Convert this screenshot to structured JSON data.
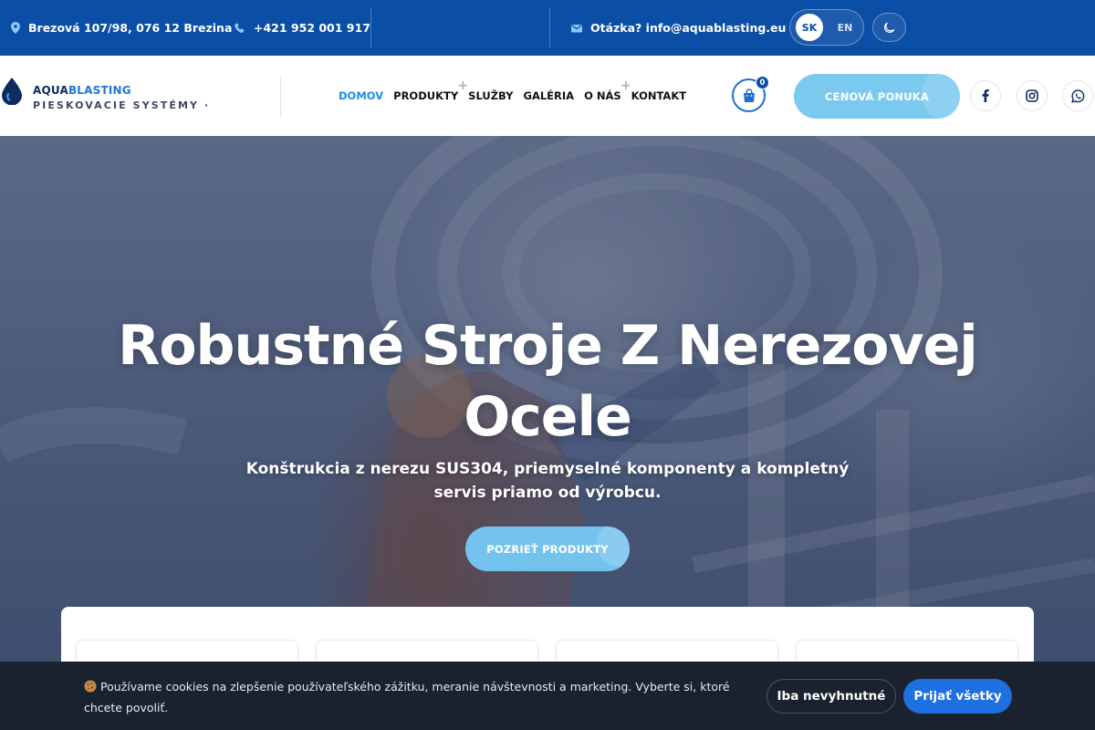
{
  "topbar": {
    "address": "Brezová 107/98, 076 12 Brezina",
    "phone": "+421 952 001 917",
    "email_label": "Otázka? info@aquablasting.eu",
    "lang_active": "SK",
    "lang_other": "EN"
  },
  "header": {
    "logo_primary": "AQUA",
    "logo_accent": "BLASTING",
    "logo_sub": "PIESKOVACIE SYSTÉMY ·",
    "nav": [
      {
        "label": "DOMOV",
        "active": true,
        "has_submenu": false
      },
      {
        "label": "PRODUKTY",
        "active": false,
        "has_submenu": true
      },
      {
        "label": "SLUŽBY",
        "active": false,
        "has_submenu": false
      },
      {
        "label": "GALÉRIA",
        "active": false,
        "has_submenu": false
      },
      {
        "label": "O NÁS",
        "active": false,
        "has_submenu": true
      },
      {
        "label": "KONTAKT",
        "active": false,
        "has_submenu": false
      }
    ],
    "submenu_symbol": "+",
    "cart_count": "0",
    "quote_button": "CENOVÁ PONUKA",
    "social_icons": [
      "facebook-icon",
      "instagram-icon",
      "whatsapp-icon"
    ]
  },
  "hero": {
    "title_line1": "Robustné Stroje Z Nerezovej",
    "title_line2": "Ocele",
    "subtitle": "Konštrukcia z nerezu SUS304, priemyselné komponenty a kompletný servis priamo od výrobcu.",
    "cta_button": "POZRIEŤ PRODUKTY"
  },
  "cookie": {
    "text": "Používame cookies na zlepšenie používateľského zážitku, meranie návštevnosti a marketing. Vyberte si, ktoré chcete povoliť.",
    "button_necessary": "Iba nevyhnutné",
    "button_accept": "Prijať všetky"
  },
  "colors": {
    "topbar": "#0b4ea6",
    "accent": "#1e8fe0",
    "cta": "#7cc9f0",
    "cookie_bg": "#1b222f",
    "accept": "#1e6fe0"
  }
}
